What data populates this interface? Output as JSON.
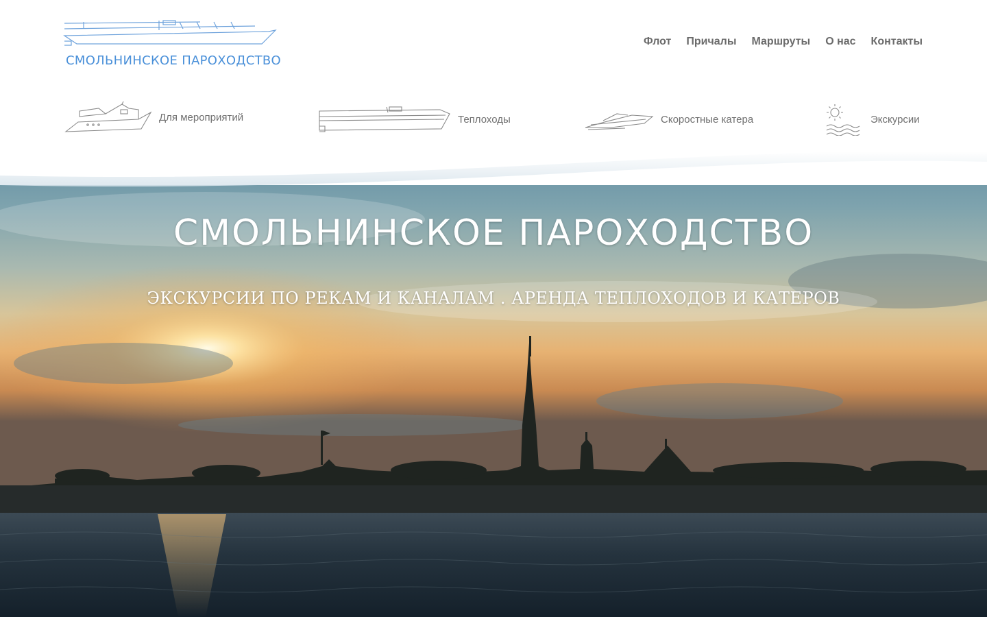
{
  "brand": {
    "logo_text": "СМОЛЬНИНСКОЕ ПАРОХОДСТВО",
    "logo_color": "#4a90d9"
  },
  "nav": {
    "items": [
      {
        "label": "Флот"
      },
      {
        "label": "Причалы"
      },
      {
        "label": "Маршруты"
      },
      {
        "label": "О нас"
      },
      {
        "label": "Контакты"
      }
    ]
  },
  "categories": [
    {
      "label": "Для мероприятий",
      "icon": "yacht-icon"
    },
    {
      "label": "Теплоходы",
      "icon": "riverboat-icon"
    },
    {
      "label": "Скоростные катера",
      "icon": "speedboat-icon"
    },
    {
      "label": "Экскурсии",
      "icon": "sun-waves-icon"
    }
  ],
  "hero": {
    "title": "СМОЛЬНИНСКОЕ ПАРОХОДСТВО",
    "subtitle": "ЭКСКУРСИИ ПО РЕКАМ И КАНАЛАМ . АРЕНДА ТЕПЛОХОДОВ И КАТЕРОВ"
  },
  "colors": {
    "nav_text": "#6b6b6b",
    "category_text": "#6f6f6f",
    "hero_text": "#ffffff"
  }
}
